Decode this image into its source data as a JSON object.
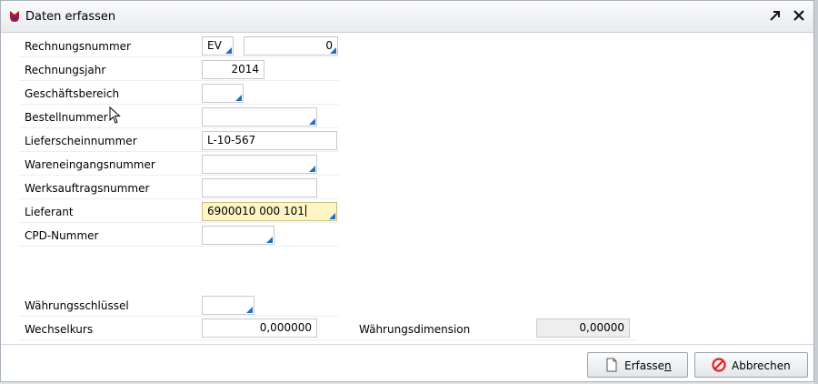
{
  "window": {
    "title": "Daten erfassen"
  },
  "form": {
    "rechnungsnummer": {
      "label": "Rechnungsnummer",
      "prefix": "EV",
      "number": "0"
    },
    "rechnungsjahr": {
      "label": "Rechnungsjahr",
      "value": "2014"
    },
    "geschaeftsbereich": {
      "label": "Geschäftsbereich",
      "value": ""
    },
    "bestellnummer": {
      "label": "Bestellnummer",
      "value": ""
    },
    "lieferscheinnummer": {
      "label": "Lieferscheinnummer",
      "value": "L-10-567"
    },
    "wareneingangsnummer": {
      "label": "Wareneingangsnummer",
      "value": ""
    },
    "werksauftragsnummer": {
      "label": "Werksauftragsnummer",
      "value": ""
    },
    "lieferant": {
      "label": "Lieferant",
      "value": "6900010 000 101"
    },
    "cpd_nummer": {
      "label": "CPD-Nummer",
      "value": ""
    },
    "waehrungsschluessel": {
      "label": "Währungsschlüssel",
      "value": ""
    },
    "wechselkurs": {
      "label": "Wechselkurs",
      "value": "0,000000"
    },
    "waehrungsdimension": {
      "label": "Währungsdimension",
      "value": "0,00000"
    }
  },
  "buttons": {
    "erfassen": {
      "label_prefix": "Erfasse",
      "label_underlined": "n"
    },
    "abbrechen": {
      "label": "Abbrechen"
    }
  },
  "icons": {
    "app": "app-logo-icon",
    "maximize": "arrow-up-right-icon",
    "close": "close-icon",
    "erfassen": "document-icon",
    "abbrechen": "cancel-circle-icon"
  },
  "colors": {
    "dropdown_marker": "#1e6fc4",
    "focus_field": "#fdf6c4",
    "cancel_icon": "#e02020"
  }
}
